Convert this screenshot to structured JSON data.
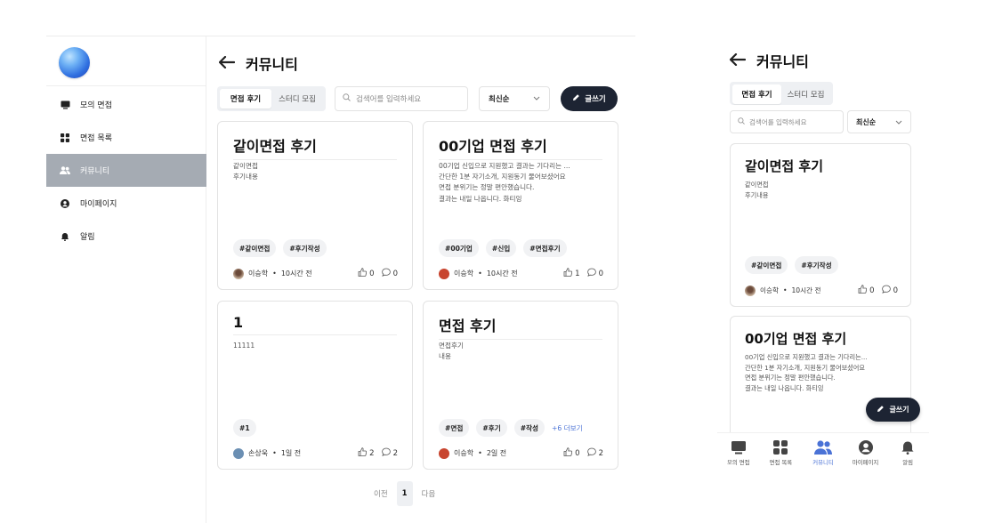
{
  "sidebar": {
    "items": [
      {
        "label": "모의 면접",
        "icon": "monitor-icon"
      },
      {
        "label": "면접 목록",
        "icon": "grid-icon"
      },
      {
        "label": "커뮤니티",
        "icon": "users-icon",
        "active": true
      },
      {
        "label": "마이페이지",
        "icon": "user-circle-icon"
      },
      {
        "label": "알림",
        "icon": "bell-icon"
      }
    ]
  },
  "header": {
    "title": "커뮤니티"
  },
  "tabs": [
    {
      "label": "면접 후기",
      "active": true
    },
    {
      "label": "스터디 모집"
    }
  ],
  "search": {
    "placeholder": "검색어를 입력하세요",
    "mobile_placeholder": "검색어를 입력하세요"
  },
  "sort": {
    "selected": "최신순"
  },
  "write_button": {
    "label": "글쓰기"
  },
  "posts": [
    {
      "title": "같이면접 후기",
      "body": "같이면접\n후기내용",
      "tags": [
        "#같이면접",
        "#후기작성"
      ],
      "author": "이승학",
      "time": "10시간 전",
      "likes": "0",
      "comments": "0"
    },
    {
      "title": "00기업 면접 후기",
      "body": "00기업 신입으로 지원했고 결과는 기다리는 ...\n간단한 1분 자기소개, 지원동기 물어보셨어요\n면접 분위기는 정말 편안했습니다.\n결과는 내일 나옵니다. 화티잉",
      "mobile_body": "00기업 신입으로 지원했고 결과는 기다리는...\n간단한 1분 자기소개, 지원동기 물어보셨어요\n면접 분위기는 정말 편안했습니다.\n결과는 내일 나옵니다. 화티잉",
      "tags": [
        "#00기업",
        "#신입",
        "#면접후기"
      ],
      "author": "이승학",
      "time": "10시간 전",
      "likes": "1",
      "comments": "0"
    },
    {
      "title": "1",
      "body": "11111",
      "tags": [
        "#1"
      ],
      "author": "손상욱",
      "time": "1일 전",
      "likes": "2",
      "comments": "2"
    },
    {
      "title": "면접 후기",
      "body": "면접후기\n내용",
      "tags": [
        "#면접",
        "#후기",
        "#작성"
      ],
      "more": "+6 더보기",
      "author": "이승학",
      "time": "2일 전",
      "likes": "0",
      "comments": "2"
    }
  ],
  "separator": "•",
  "pagination": {
    "prev": "이전",
    "current": "1",
    "next": "다음"
  },
  "mobile_nav": [
    {
      "label": "모의 면접",
      "icon": "monitor-icon"
    },
    {
      "label": "면접 목록",
      "icon": "grid-icon"
    },
    {
      "label": "커뮤니티",
      "icon": "users-icon",
      "active": true
    },
    {
      "label": "마이페이지",
      "icon": "user-circle-icon"
    },
    {
      "label": "알림",
      "icon": "bell-icon"
    }
  ],
  "colors": {
    "accent": "#4a72d6",
    "dark_button": "#1d2433",
    "active_sidebar": "#a5abb3"
  }
}
